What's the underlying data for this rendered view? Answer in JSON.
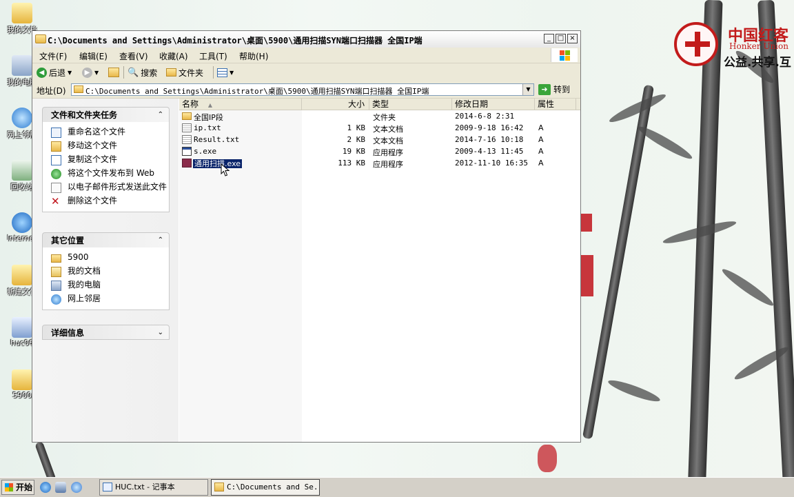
{
  "desktop": {
    "icons": [
      {
        "label": "我的文档"
      },
      {
        "label": "我的电脑"
      },
      {
        "label": "网上邻居"
      },
      {
        "label": "回收站"
      },
      {
        "label": "Internet Explorer"
      },
      {
        "label": "新建文件夹"
      },
      {
        "label": "huc06"
      },
      {
        "label": "5900"
      }
    ],
    "logo": {
      "cn": "中国红客",
      "en": "Honker Union",
      "slogan": "公益.共享.互"
    }
  },
  "window": {
    "title": "C:\\Documents and Settings\\Administrator\\桌面\\5900\\通用扫描SYN端口扫描器  全国IP端",
    "controls": {
      "minimize": "_",
      "maximize": "□",
      "close": "×"
    },
    "menu": [
      "文件(F)",
      "编辑(E)",
      "查看(V)",
      "收藏(A)",
      "工具(T)",
      "帮助(H)"
    ],
    "toolbar": {
      "back": "后退",
      "search": "搜索",
      "folders": "文件夹"
    },
    "address": {
      "label": "地址(D)",
      "value": "C:\\Documents and Settings\\Administrator\\桌面\\5900\\通用扫描SYN端口扫描器  全国IP端",
      "go": "转到"
    }
  },
  "taskpane": {
    "file_tasks": {
      "title": "文件和文件夹任务",
      "items": [
        "重命名这个文件",
        "移动这个文件",
        "复制这个文件",
        "将这个文件发布到 Web",
        "以电子邮件形式发送此文件",
        "删除这个文件"
      ]
    },
    "other_places": {
      "title": "其它位置",
      "items": [
        "5900",
        "我的文档",
        "我的电脑",
        "网上邻居"
      ]
    },
    "details": {
      "title": "详细信息"
    }
  },
  "filelist": {
    "columns": {
      "name": "名称",
      "size": "大小",
      "type": "类型",
      "modified": "修改日期",
      "attributes": "属性"
    },
    "rows": [
      {
        "name": "全国IP段",
        "size": "",
        "type": "文件夹",
        "modified": "2014-6-8 2:31",
        "attr": "",
        "icon": "folder-icon"
      },
      {
        "name": "ip.txt",
        "size": "1 KB",
        "type": "文本文档",
        "modified": "2009-9-18 16:42",
        "attr": "A",
        "icon": "text-file-icon"
      },
      {
        "name": "Result.txt",
        "size": "2 KB",
        "type": "文本文档",
        "modified": "2014-7-16 10:18",
        "attr": "A",
        "icon": "text-file-icon"
      },
      {
        "name": "s.exe",
        "size": "19 KB",
        "type": "应用程序",
        "modified": "2009-4-13 11:45",
        "attr": "A",
        "icon": "exe-icon"
      },
      {
        "name": "通用扫描.exe",
        "size": "113 KB",
        "type": "应用程序",
        "modified": "2012-11-10 16:35",
        "attr": "A",
        "icon": "app-icon",
        "selected": true
      }
    ]
  },
  "taskbar": {
    "start": "开始",
    "buttons": [
      {
        "label": "HUC.txt - 记事本"
      },
      {
        "label": "C:\\Documents and Se..."
      }
    ]
  }
}
